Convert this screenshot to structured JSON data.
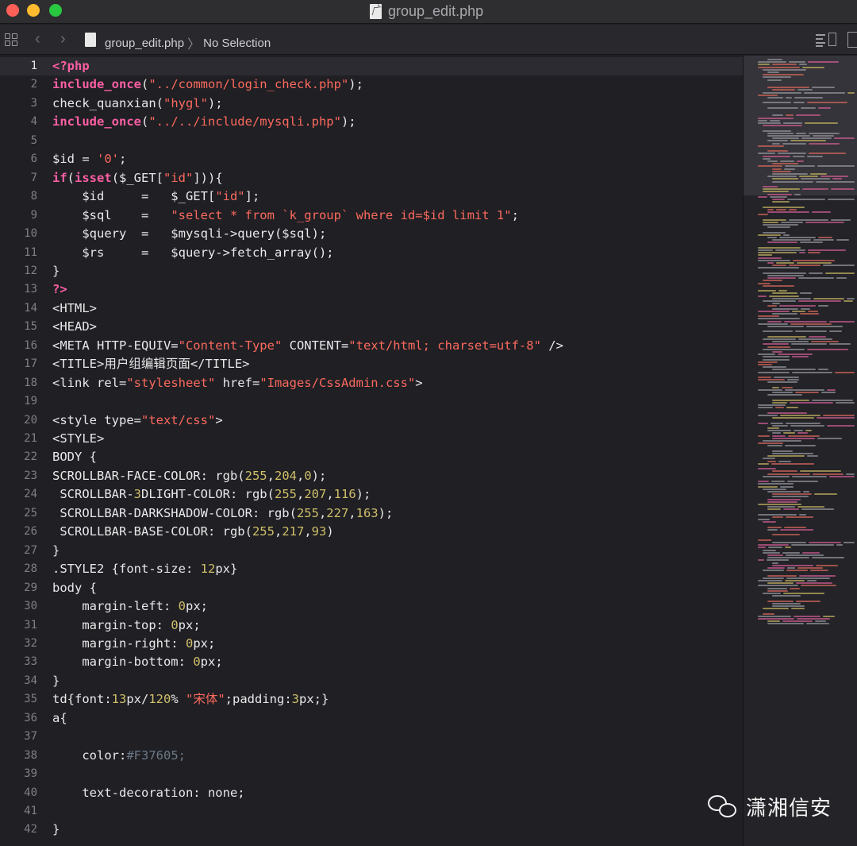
{
  "window": {
    "title": "group_edit.php",
    "traffic_lights": [
      "#fe5f57",
      "#febc2e",
      "#28c840"
    ]
  },
  "jumpbar": {
    "file": "group_edit.php",
    "selection": "No Selection",
    "back_icon": "chevron-left-icon",
    "forward_icon": "chevron-right-icon"
  },
  "editor": {
    "active_line": 1,
    "colors": {
      "keyword": "#fc5fa3",
      "string": "#fc6a5d",
      "number": "#d0bf69",
      "plain": "#e9e9ea",
      "comment": "#6c7986"
    },
    "lines": [
      {
        "n": "1",
        "tokens": [
          [
            "kw",
            "<?php"
          ]
        ]
      },
      {
        "n": "2",
        "tokens": [
          [
            "kw",
            "include_once"
          ],
          [
            "p",
            "("
          ],
          [
            "str",
            "\"../common/login_check.php\""
          ],
          [
            "p",
            ");"
          ]
        ]
      },
      {
        "n": "3",
        "tokens": [
          [
            "p",
            "check_quanxian("
          ],
          [
            "str",
            "\"hygl\""
          ],
          [
            "p",
            ");"
          ]
        ]
      },
      {
        "n": "4",
        "tokens": [
          [
            "kw",
            "include_once"
          ],
          [
            "p",
            "("
          ],
          [
            "str",
            "\"../../include/mysqli.php\""
          ],
          [
            "p",
            ");"
          ]
        ]
      },
      {
        "n": "5",
        "tokens": []
      },
      {
        "n": "6",
        "tokens": [
          [
            "p",
            "$id = "
          ],
          [
            "str",
            "'0'"
          ],
          [
            "p",
            ";"
          ]
        ]
      },
      {
        "n": "7",
        "tokens": [
          [
            "kw",
            "if"
          ],
          [
            "p",
            "("
          ],
          [
            "kw",
            "isset"
          ],
          [
            "p",
            "($_GET["
          ],
          [
            "str",
            "\"id\""
          ],
          [
            "p",
            "])){"
          ]
        ]
      },
      {
        "n": "8",
        "tokens": [
          [
            "p",
            "    $id     =   $_GET["
          ],
          [
            "str",
            "\"id\""
          ],
          [
            "p",
            "];"
          ]
        ]
      },
      {
        "n": "9",
        "tokens": [
          [
            "p",
            "    $sql    =   "
          ],
          [
            "str",
            "\"select * from `k_group` where id=$id limit 1\""
          ],
          [
            "p",
            ";"
          ]
        ]
      },
      {
        "n": "10",
        "tokens": [
          [
            "p",
            "    $query  =   $mysqli->query($sql);"
          ]
        ]
      },
      {
        "n": "11",
        "tokens": [
          [
            "p",
            "    $rs     =   $query->fetch_array();"
          ]
        ]
      },
      {
        "n": "12",
        "tokens": [
          [
            "p",
            "}"
          ]
        ]
      },
      {
        "n": "13",
        "tokens": [
          [
            "kw",
            "?>"
          ]
        ]
      },
      {
        "n": "14",
        "tokens": [
          [
            "p",
            "<HTML>"
          ]
        ]
      },
      {
        "n": "15",
        "tokens": [
          [
            "p",
            "<HEAD>"
          ]
        ]
      },
      {
        "n": "16",
        "tokens": [
          [
            "p",
            "<META HTTP-EQUIV="
          ],
          [
            "str",
            "\"Content-Type\""
          ],
          [
            "p",
            " CONTENT="
          ],
          [
            "str",
            "\"text/html; charset=utf-8\""
          ],
          [
            "p",
            " />"
          ]
        ]
      },
      {
        "n": "17",
        "tokens": [
          [
            "p",
            "<TITLE>用户组编辑页面</TITLE>"
          ]
        ]
      },
      {
        "n": "18",
        "tokens": [
          [
            "p",
            "<link rel="
          ],
          [
            "str",
            "\"stylesheet\""
          ],
          [
            "p",
            " href="
          ],
          [
            "str",
            "\"Images/CssAdmin.css\""
          ],
          [
            "p",
            ">"
          ]
        ]
      },
      {
        "n": "19",
        "tokens": []
      },
      {
        "n": "20",
        "tokens": [
          [
            "p",
            "<style type="
          ],
          [
            "str",
            "\"text/css\""
          ],
          [
            "p",
            ">"
          ]
        ]
      },
      {
        "n": "21",
        "tokens": [
          [
            "p",
            "<STYLE>"
          ]
        ]
      },
      {
        "n": "22",
        "tokens": [
          [
            "p",
            "BODY {"
          ]
        ]
      },
      {
        "n": "23",
        "tokens": [
          [
            "p",
            "SCROLLBAR-FACE-COLOR: rgb("
          ],
          [
            "num",
            "255"
          ],
          [
            "p",
            ","
          ],
          [
            "num",
            "204"
          ],
          [
            "p",
            ","
          ],
          [
            "num",
            "0"
          ],
          [
            "p",
            ");"
          ]
        ]
      },
      {
        "n": "24",
        "tokens": [
          [
            "p",
            " SCROLLBAR-"
          ],
          [
            "num",
            "3"
          ],
          [
            "p",
            "DLIGHT-COLOR: rgb("
          ],
          [
            "num",
            "255"
          ],
          [
            "p",
            ","
          ],
          [
            "num",
            "207"
          ],
          [
            "p",
            ","
          ],
          [
            "num",
            "116"
          ],
          [
            "p",
            ");"
          ]
        ]
      },
      {
        "n": "25",
        "tokens": [
          [
            "p",
            " SCROLLBAR-DARKSHADOW-COLOR: rgb("
          ],
          [
            "num",
            "255"
          ],
          [
            "p",
            ","
          ],
          [
            "num",
            "227"
          ],
          [
            "p",
            ","
          ],
          [
            "num",
            "163"
          ],
          [
            "p",
            ");"
          ]
        ]
      },
      {
        "n": "26",
        "tokens": [
          [
            "p",
            " SCROLLBAR-BASE-COLOR: rgb("
          ],
          [
            "num",
            "255"
          ],
          [
            "p",
            ","
          ],
          [
            "num",
            "217"
          ],
          [
            "p",
            ","
          ],
          [
            "num",
            "93"
          ],
          [
            "p",
            ")"
          ]
        ]
      },
      {
        "n": "27",
        "tokens": [
          [
            "p",
            "}"
          ]
        ]
      },
      {
        "n": "28",
        "tokens": [
          [
            "p",
            ".STYLE2 {font-size: "
          ],
          [
            "num",
            "12"
          ],
          [
            "p",
            "px}"
          ]
        ]
      },
      {
        "n": "29",
        "tokens": [
          [
            "p",
            "body {"
          ]
        ]
      },
      {
        "n": "30",
        "tokens": [
          [
            "p",
            "    margin-left: "
          ],
          [
            "num",
            "0"
          ],
          [
            "p",
            "px;"
          ]
        ]
      },
      {
        "n": "31",
        "tokens": [
          [
            "p",
            "    margin-top: "
          ],
          [
            "num",
            "0"
          ],
          [
            "p",
            "px;"
          ]
        ]
      },
      {
        "n": "32",
        "tokens": [
          [
            "p",
            "    margin-right: "
          ],
          [
            "num",
            "0"
          ],
          [
            "p",
            "px;"
          ]
        ]
      },
      {
        "n": "33",
        "tokens": [
          [
            "p",
            "    margin-bottom: "
          ],
          [
            "num",
            "0"
          ],
          [
            "p",
            "px;"
          ]
        ]
      },
      {
        "n": "34",
        "tokens": [
          [
            "p",
            "}"
          ]
        ]
      },
      {
        "n": "35",
        "tokens": [
          [
            "p",
            "td{font:"
          ],
          [
            "num",
            "13"
          ],
          [
            "p",
            "px/"
          ],
          [
            "num",
            "120"
          ],
          [
            "p",
            "% "
          ],
          [
            "str",
            "\"宋体\""
          ],
          [
            "p",
            ";padding:"
          ],
          [
            "num",
            "3"
          ],
          [
            "p",
            "px;}"
          ]
        ]
      },
      {
        "n": "36",
        "tokens": [
          [
            "p",
            "a{"
          ]
        ]
      },
      {
        "n": "37",
        "tokens": []
      },
      {
        "n": "38",
        "tokens": [
          [
            "p",
            "    color:"
          ],
          [
            "cmt",
            "#F37605;"
          ]
        ]
      },
      {
        "n": "39",
        "tokens": []
      },
      {
        "n": "40",
        "tokens": [
          [
            "p",
            "    text-decoration: none;"
          ]
        ]
      },
      {
        "n": "41",
        "tokens": []
      },
      {
        "n": "42",
        "tokens": [
          [
            "p",
            "}"
          ]
        ]
      }
    ]
  },
  "minimap": {
    "icon": "code-minimap"
  },
  "watermark": {
    "icon": "wechat-icon",
    "text": "潇湘信安"
  }
}
